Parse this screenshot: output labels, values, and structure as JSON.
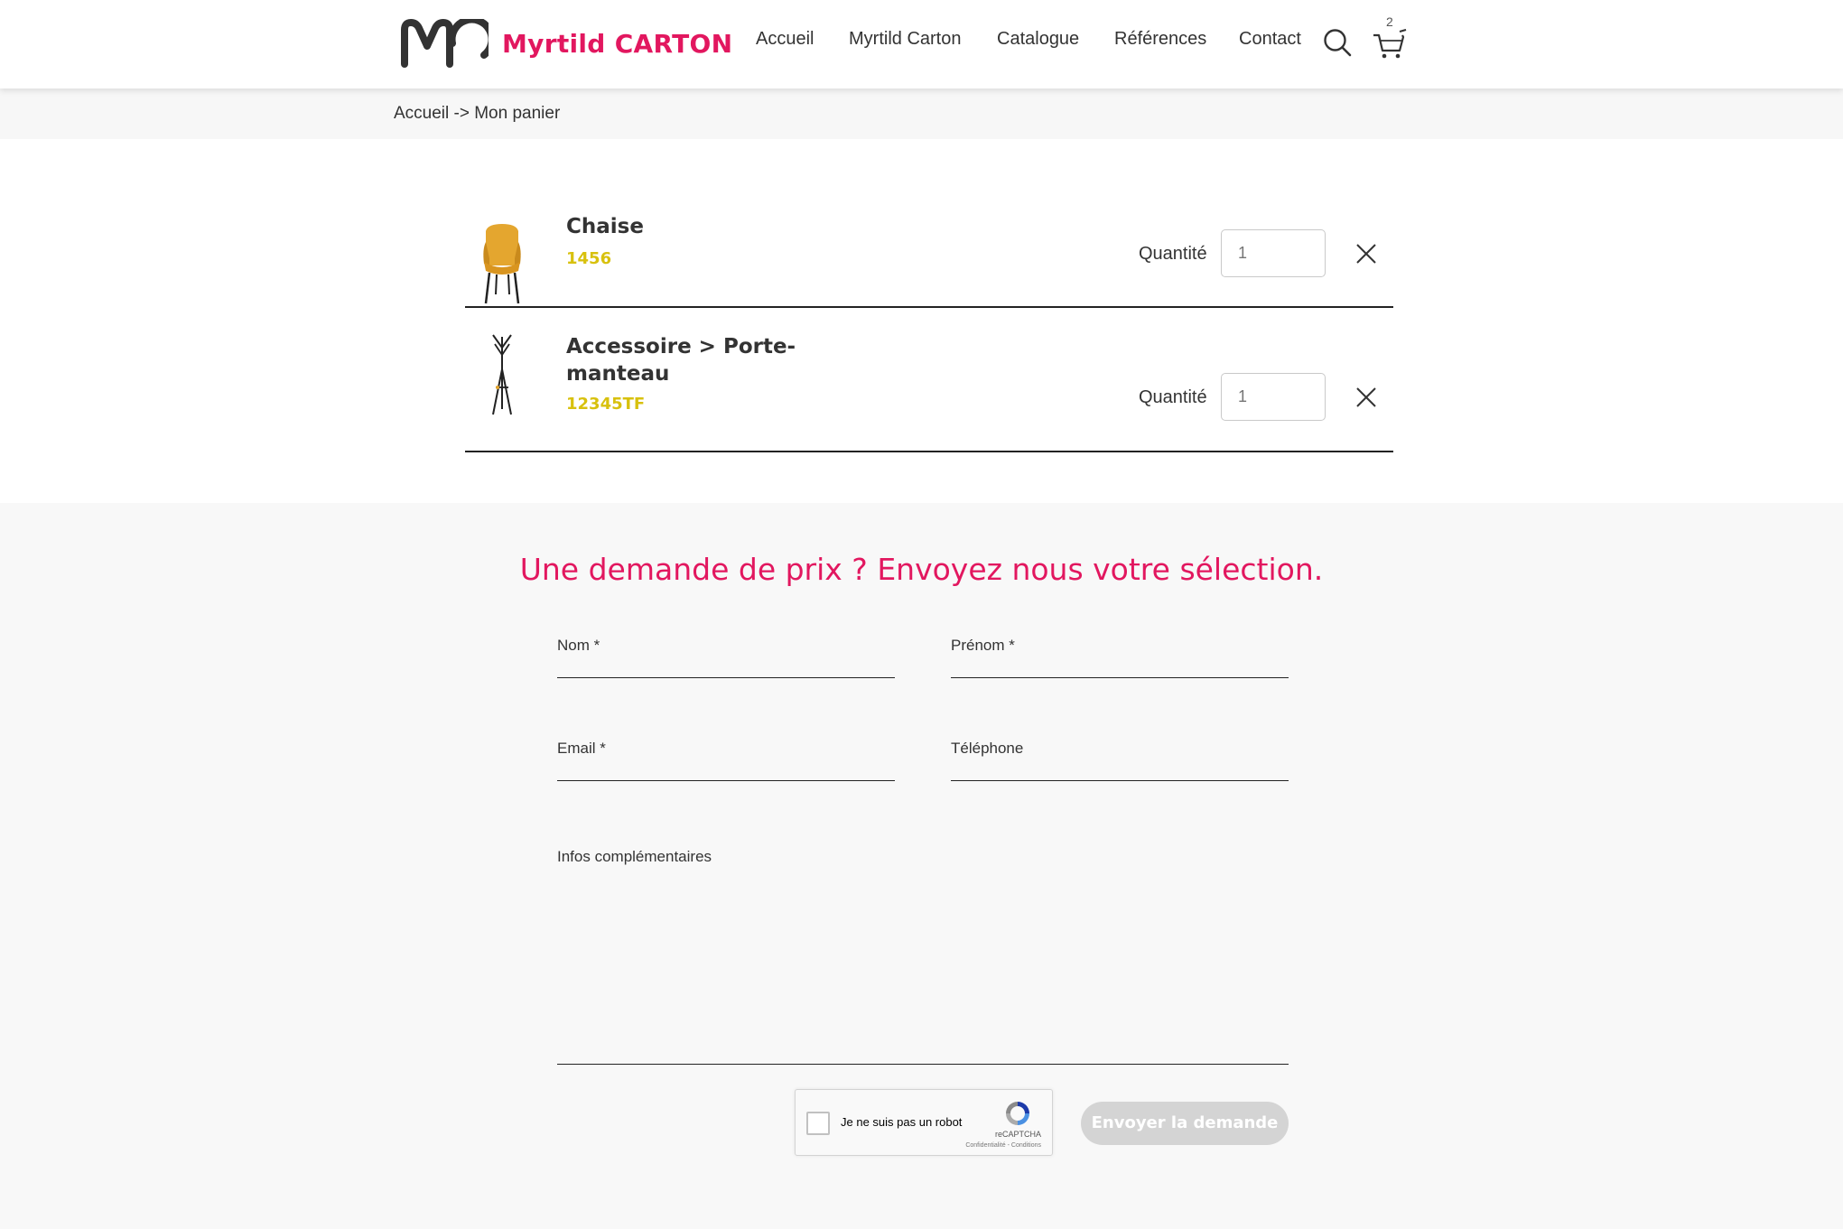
{
  "brand": {
    "name": "Myrtild CARTON",
    "color": "#e2175f"
  },
  "nav": {
    "items": [
      {
        "label": "Accueil"
      },
      {
        "label": "Myrtild Carton"
      },
      {
        "label": "Catalogue"
      },
      {
        "label": "Références"
      },
      {
        "label": "Contact"
      }
    ],
    "search_icon": "search-icon",
    "cart_icon": "cart-icon",
    "cart_count": "2"
  },
  "breadcrumb": "Accueil -> Mon panier",
  "cart": {
    "items": [
      {
        "name": "Chaise",
        "ref": "1456",
        "qty_label": "Quantité",
        "qty_placeholder": "1",
        "image": "chair"
      },
      {
        "name": "Accessoire > Porte-manteau",
        "ref": "12345TF",
        "qty_label": "Quantité",
        "qty_placeholder": "1",
        "image": "coat-rack"
      }
    ]
  },
  "form": {
    "title": "Une demande de prix ? Envoyez nous votre sélection.",
    "labels": {
      "nom": "Nom *",
      "prenom": "Prénom *",
      "email": "Email *",
      "telephone": "Téléphone",
      "infos": "Infos complémentaires"
    },
    "captcha": {
      "label": "Je ne suis pas un robot",
      "brand": "reCAPTCHA",
      "terms": "Confidentialité - Conditions"
    },
    "submit_label": "Envoyer la demande"
  },
  "colors": {
    "accent": "#e2175f",
    "ref": "#d8c10e",
    "button_disabled": "#d4d4d4"
  }
}
